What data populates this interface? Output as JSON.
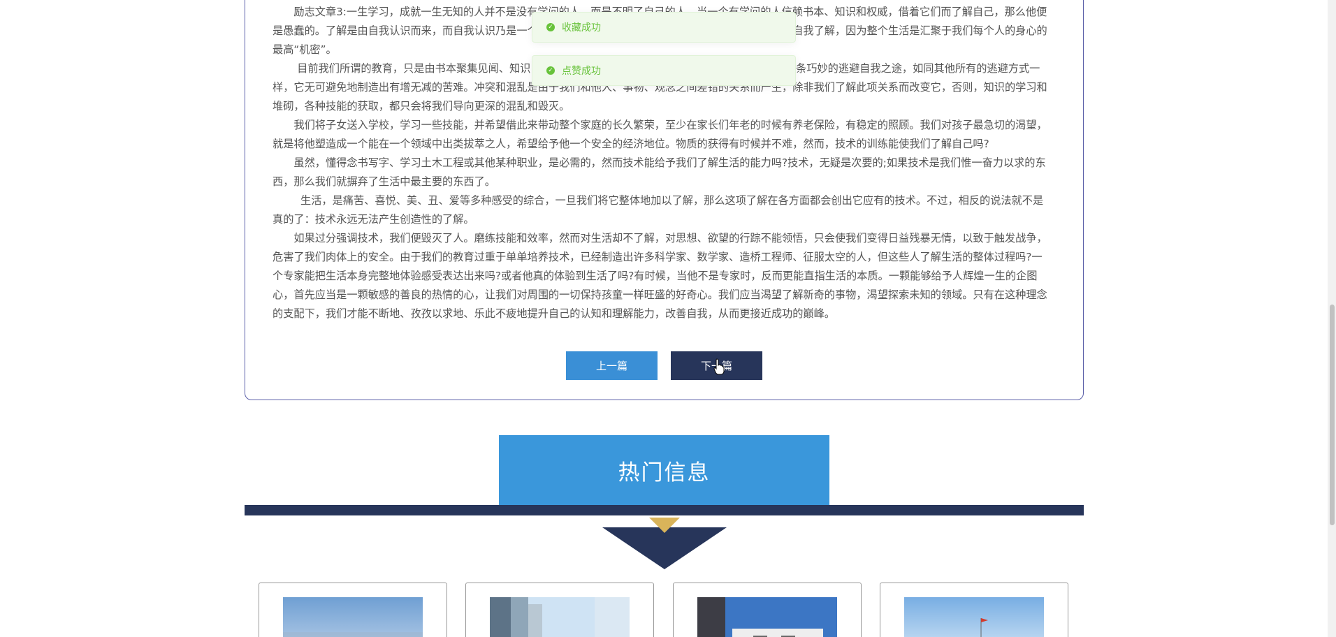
{
  "article": {
    "paragraphs": [
      "　　励志文章3:一生学习，成就一生无知的人并不是没有学问的人，而是不明了自己的人。当一个有学问的人信赖书本、知识和权威，借着它们而了解自己，那么他便是愚蠢的。了解是由自我认识而来，而自我认识乃是一个人认识他整体的心理过程。因此，教育真正的意义就是自我了解，因为整个生活是汇聚于我们每个人的身心的最高“机密”。",
      "　　 目前我们所谓的教育，只是由书本聚集见闻、知识，这是任何能阅读的人都能做到的事。这种教育提供了一条巧妙的逃避自我之途，如同其他所有的逃避方式一样，它无可避免地制造出有增无减的苦难。冲突和混乱是由于我们和他人、事物、观念之间差错的关系而产生，除非我们了解此项关系而改变它，否则，知识的学习和堆砌，各种技能的获取，都只会将我们导向更深的混乱和毁灭。",
      "　　我们将子女送入学校，学习一些技能，并希望借此来带动整个家庭的长久繁荣，至少在家长们年老的时候有养老保险，有稳定的照顾。我们对孩子最急切的渴望，就是将他塑造成一个能在一个领域中出类拔萃之人，希望给予他一个安全的经济地位。物质的获得有时候并不难，然而，技术的训练能使我们了解自己吗?",
      "　　虽然，懂得念书写字、学习土木工程或其他某种职业，是必需的，然而技术能给予我们了解生活的能力吗?技术，无疑是次要的;如果技术是我们惟一奋力以求的东西，那么我们就摒弃了生活中最主要的东西了。",
      "　　  生活，是痛苦、喜悦、美、丑、爱等多种感受的综合，一旦我们将它整体地加以了解，那么这项了解在各方面都会创出它应有的技术。不过，相反的说法就不是真的了：技术永远无法产生创造性的了解。",
      "　　如果过分强调技术，我们便毁灭了人。磨练技能和效率，然而对生活却不了解，对思想、欲望的行踪不能领悟，只会使我们变得日益残暴无情，以致于触发战争，危害了我们肉体上的安全。由于我们的教育过重于单单培养技术，已经制造出许多科学家、数学家、造桥工程师、征服太空的人，但这些人了解生活的整体过程吗?一个专家能把生活本身完整地体验感受表达出来吗?或者他真的体验到生活了吗?有时候，当他不是专家时，反而更能直指生活的本质。一颗能够给予人辉煌一生的企图心，首先应当是一颗敏感的善良的热情的心，让我们对周围的一切保持孩童一样旺盛的好奇心。我们应当渴望了解新奇的事物，渴望探索未知的领域。只有在这种理念的支配下，我们才能不断地、孜孜以求地、乐此不疲地提升自己的认知和理解能力，改善自我，从而更接近成功的巅峰。"
    ],
    "prev_label": "上一篇",
    "next_label": "下一篇"
  },
  "toasts": [
    {
      "message": "收藏成功",
      "icon": "success-check-icon"
    },
    {
      "message": "点赞成功",
      "icon": "success-check-icon"
    }
  ],
  "hot_section": {
    "title": "热门信息",
    "colors": {
      "accent": "#3a97db",
      "navy": "#27355a",
      "gold": "#d9b45a"
    }
  },
  "thumbnails": [
    {
      "alt": "sky-building-photo"
    },
    {
      "alt": "high-rise-photo"
    },
    {
      "alt": "campus-building-photo"
    },
    {
      "alt": "flag-sky-photo"
    }
  ]
}
